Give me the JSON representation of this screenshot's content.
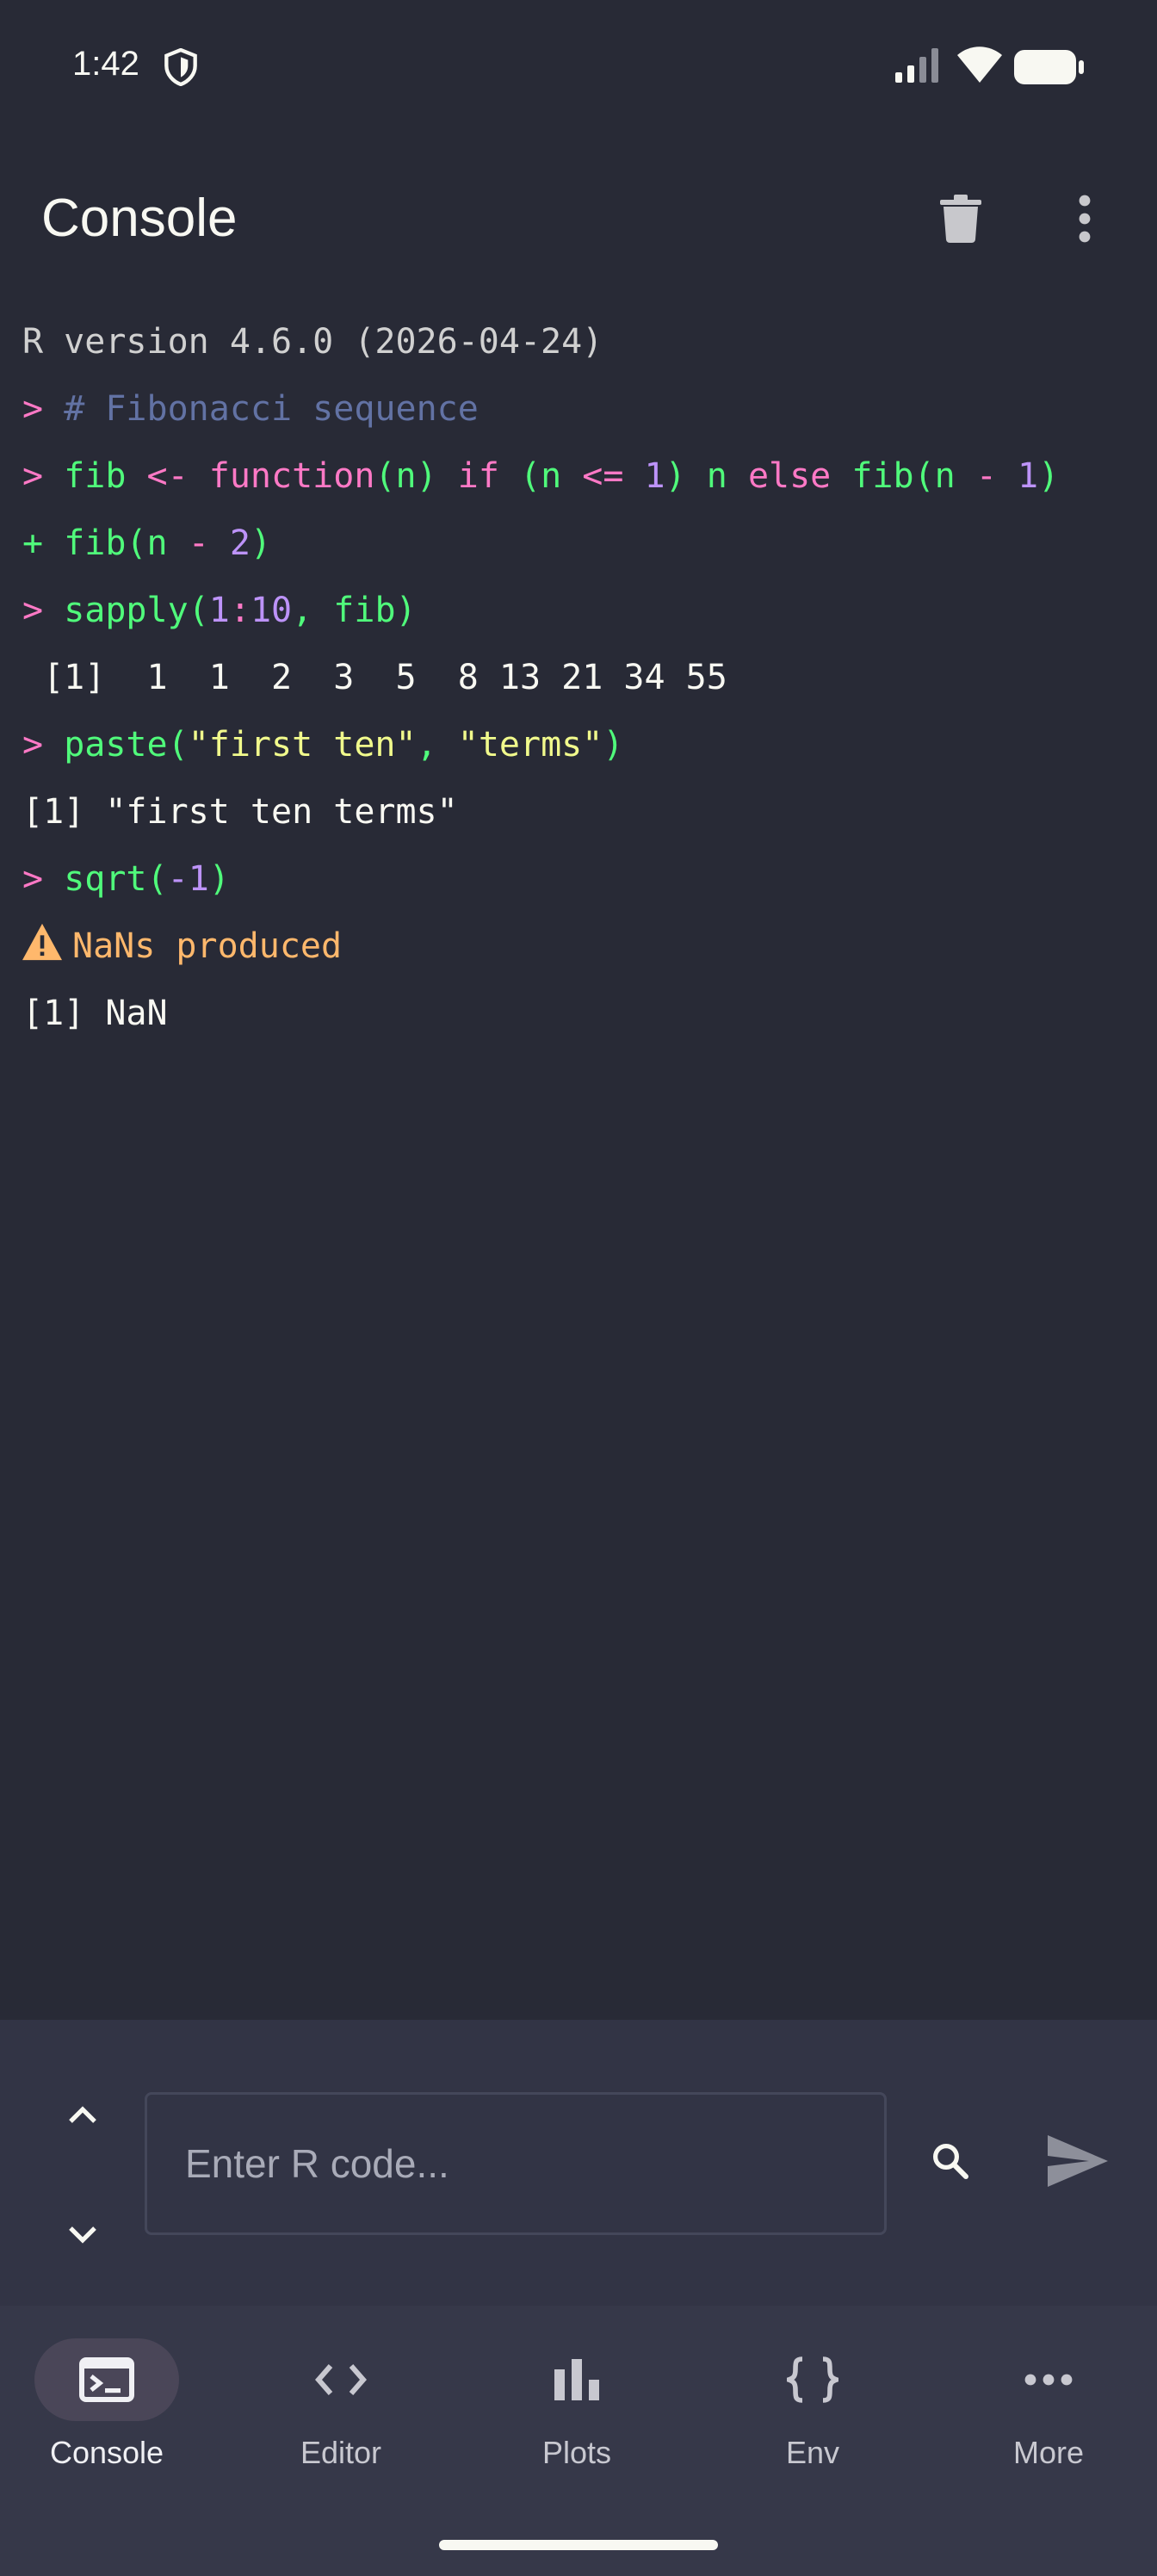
{
  "status_bar": {
    "time": "1:42",
    "icons": [
      "shield-icon",
      "signal-icon",
      "wifi-icon",
      "battery-icon"
    ]
  },
  "app_bar": {
    "title": "Console",
    "actions": [
      "trash-icon",
      "more-vert-icon"
    ]
  },
  "console": {
    "version_line": "R version 4.6.0 (2026-04-24)",
    "prompt_symbol": ">",
    "continuation_symbol": "+",
    "lines": {
      "l1": "# Fibonacci sequence",
      "l2_a": "fib",
      "l2_b": " <- ",
      "l2_c": "function",
      "l2_d": "(n) ",
      "l2_e": "if",
      "l2_f": " (n ",
      "l2_g": "<=",
      "l2_h": " ",
      "l2_i": "1",
      "l2_j": ") n ",
      "l2_k": "else",
      "l2_l": " fib(n ",
      "l2_m": "-",
      "l2_n": " ",
      "l2_o": "1",
      "l2_p": ")",
      "l3_a": "fib(n ",
      "l3_b": "-",
      "l3_c": " ",
      "l3_d": "2",
      "l3_e": ")",
      "l4_a": "sapply(",
      "l4_b": "1",
      "l4_c": ":",
      "l4_d": "10",
      "l4_e": ", fib)",
      "l5": " [1]  1  1  2  3  5  8 13 21 34 55",
      "l6_a": "paste(",
      "l6_b": "\"first ten\"",
      "l6_c": ", ",
      "l6_d": "\"terms\"",
      "l6_e": ")",
      "l7": "[1] \"first ten terms\"",
      "l8_a": "sqrt(",
      "l8_b": "-1",
      "l8_c": ")",
      "l9": "NaNs produced",
      "l10": "[1] NaN"
    }
  },
  "input_panel": {
    "placeholder": "Enter R code...",
    "value": ""
  },
  "bottom_nav": {
    "items": [
      {
        "label": "Console",
        "icon": "terminal-icon"
      },
      {
        "label": "Editor",
        "icon": "code-icon"
      },
      {
        "label": "Plots",
        "icon": "bar-chart-icon"
      },
      {
        "label": "Env",
        "icon": "braces-icon"
      },
      {
        "label": "More",
        "icon": "more-horiz-icon"
      }
    ]
  },
  "colors": {
    "background": "#282a36",
    "input_panel": "#323445",
    "nav_background": "#363849",
    "prompt": "#ff79c6",
    "comment": "#6272a4",
    "function": "#50fa7b",
    "number": "#bd93f9",
    "string": "#f1fa8c",
    "warning": "#ffb86c"
  }
}
